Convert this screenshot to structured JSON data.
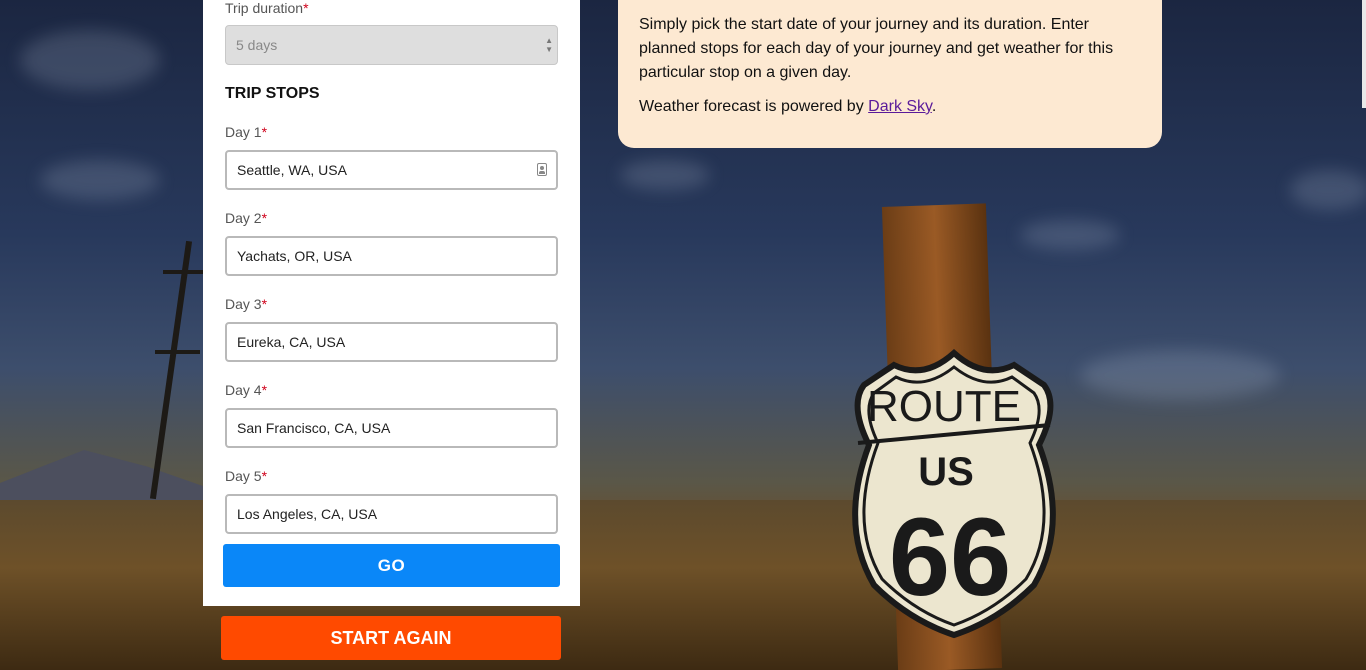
{
  "trip": {
    "duration_label": "Trip duration",
    "required_mark": "*",
    "duration_value": "5 days",
    "stops_title": "TRIP STOPS",
    "stops": [
      {
        "label": "Day 1",
        "value": "Seattle, WA, USA"
      },
      {
        "label": "Day 2",
        "value": "Yachats, OR, USA"
      },
      {
        "label": "Day 3",
        "value": "Eureka, CA, USA"
      },
      {
        "label": "Day 4",
        "value": "San Francisco, CA, USA"
      },
      {
        "label": "Day 5",
        "value": "Los Angeles, CA, USA"
      }
    ],
    "go_label": "GO",
    "start_again_label": "START AGAIN"
  },
  "info": {
    "paragraph1": "Simply pick the start date of your journey and its duration. Enter planned stops for each day of your journey and get weather for this particular stop on a given day.",
    "paragraph2_prefix": "Weather forecast is powered by ",
    "link_text": "Dark Sky",
    "paragraph2_suffix": "."
  },
  "sign": {
    "line1": "ROUTE",
    "line2": "US",
    "line3": "66"
  },
  "colors": {
    "go_button": "#0a87f8",
    "start_again_button": "#ff4a00",
    "info_card": "#fde9d2",
    "required": "#d0021b"
  }
}
